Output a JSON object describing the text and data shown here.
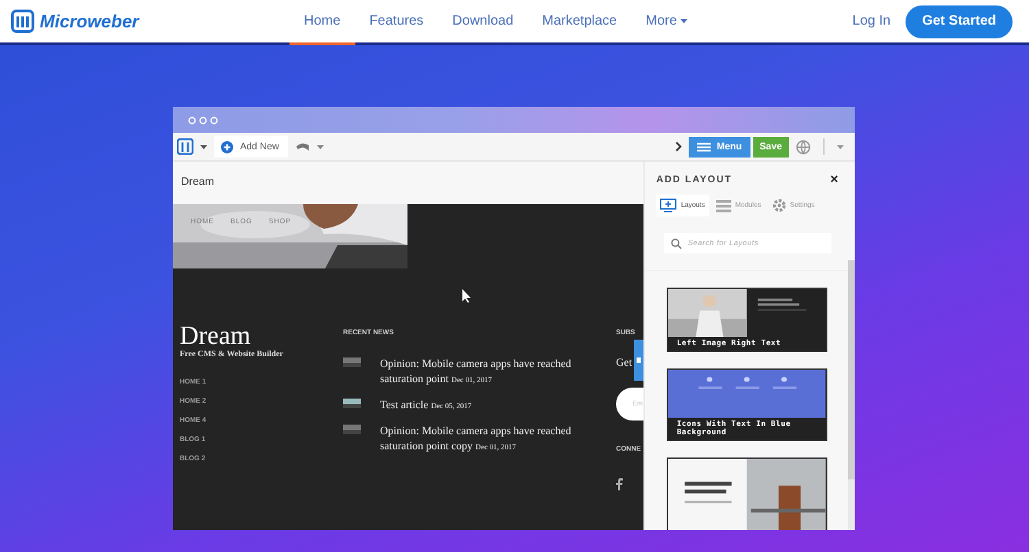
{
  "nav": {
    "brand": "Microweber",
    "links": [
      {
        "label": "Home",
        "selected": true
      },
      {
        "label": "Features",
        "selected": false
      },
      {
        "label": "Download",
        "selected": false
      },
      {
        "label": "Marketplace",
        "selected": false
      },
      {
        "label": "More",
        "selected": false,
        "dropdown": true
      }
    ],
    "login": "Log In",
    "cta": "Get Started"
  },
  "editor": {
    "add_new": "Add New",
    "menu": "Menu",
    "save": "Save",
    "page_title": "Dream",
    "site": {
      "nav_items": [
        "HOME",
        "BLOG",
        "SHOP"
      ],
      "brand": "Dream",
      "tagline": "Free CMS & Website Builder",
      "menu_links": [
        "HOME 1",
        "HOME 2",
        "HOME 4",
        "BLOG 1",
        "BLOG 2"
      ],
      "news_heading": "RECENT NEWS",
      "news": [
        {
          "title": "Opinion: Mobile camera apps have reached saturation point",
          "date": "Dec 01, 2017"
        },
        {
          "title": "Test article",
          "date": "Dec 05, 2017"
        },
        {
          "title": "Opinion: Mobile camera apps have reached saturation point copy",
          "date": "Dec 01, 2017"
        }
      ],
      "subscribe_heading": "SUBS",
      "subscribe_text": "Get",
      "email_placeholder": "Em",
      "connect_heading": "CONNE"
    },
    "panel": {
      "title": "ADD LAYOUT",
      "close": "×",
      "tabs": [
        {
          "label": "Layouts",
          "selected": true
        },
        {
          "label": "Modules",
          "selected": false
        },
        {
          "label": "Settings",
          "selected": false
        }
      ],
      "search": {
        "placeholder": "Search for Layouts"
      },
      "layouts": [
        {
          "kind": "dark",
          "caption": "Left Image Right Text"
        },
        {
          "kind": "blue",
          "caption": "Icons With Text In Blue Background"
        },
        {
          "kind": "light"
        }
      ]
    }
  }
}
